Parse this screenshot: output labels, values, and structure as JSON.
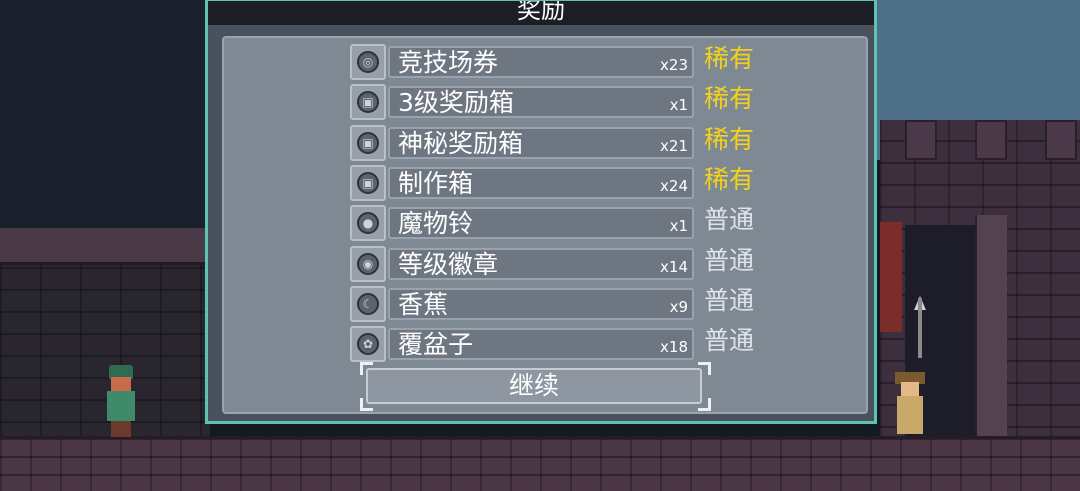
{
  "dialog": {
    "title": "奖励",
    "continue_label": "继续",
    "rarity_colors": {
      "rare": "#f2d21c",
      "common": "#dfe3e8"
    },
    "accent_border": "#5ec3b3",
    "items": [
      {
        "name": "竞技场券",
        "qty": "x23",
        "rarity": "稀有",
        "tier": "rare",
        "icon": "coin-icon",
        "glyph": "◎"
      },
      {
        "name": "3级奖励箱",
        "qty": "x1",
        "rarity": "稀有",
        "tier": "rare",
        "icon": "chest-icon",
        "glyph": "▣"
      },
      {
        "name": "神秘奖励箱",
        "qty": "x21",
        "rarity": "稀有",
        "tier": "rare",
        "icon": "chest-icon",
        "glyph": "▣"
      },
      {
        "name": "制作箱",
        "qty": "x24",
        "rarity": "稀有",
        "tier": "rare",
        "icon": "chest-icon",
        "glyph": "▣"
      },
      {
        "name": "魔物铃",
        "qty": "x1",
        "rarity": "普通",
        "tier": "common",
        "icon": "bell-icon",
        "glyph": "●"
      },
      {
        "name": "等级徽章",
        "qty": "x14",
        "rarity": "普通",
        "tier": "common",
        "icon": "badge-icon",
        "glyph": "◉"
      },
      {
        "name": "香蕉",
        "qty": "x9",
        "rarity": "普通",
        "tier": "common",
        "icon": "banana-icon",
        "glyph": "☾"
      },
      {
        "name": "覆盆子",
        "qty": "x18",
        "rarity": "普通",
        "tier": "common",
        "icon": "raspberry-icon",
        "glyph": "✿"
      }
    ]
  }
}
